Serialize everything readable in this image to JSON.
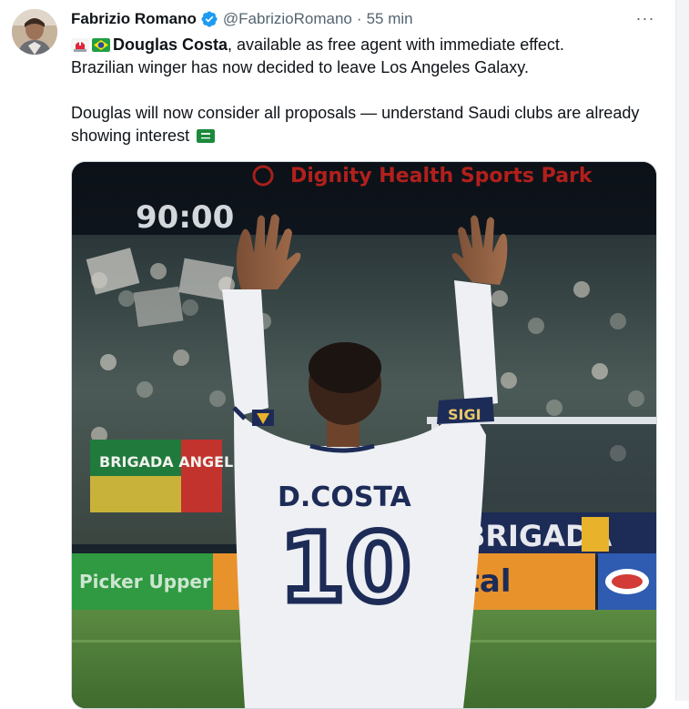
{
  "tweet": {
    "author": {
      "display_name": "Fabrizio Romano",
      "handle": "@FabrizioRomano",
      "verified": true,
      "avatar_icon": "avatar-photo"
    },
    "separator": "·",
    "time": "55 min",
    "more_icon": "more-horizontal-icon",
    "more_label": "···",
    "text": {
      "line1_flags": [
        "siren-emoji",
        "brazil-flag"
      ],
      "player_name": "Douglas Costa",
      "line1_rest": ", available as free agent with immediate effect.",
      "line2": "Brazilian winger has now decided to leave Los Angeles Galaxy.",
      "para2": "Douglas will now consider all proposals — understand Saudi clubs are already showing interest",
      "para2_flag": "saudi-flag"
    },
    "media": {
      "stadium_sign": "Dignity Health Sports Park",
      "scoreboard": "90:00",
      "jersey_name": "D.COSTA",
      "jersey_number": "10",
      "armband": "SIGI",
      "banner_left": "BRIGADA ANGELES",
      "banner_right": "BRIGADA",
      "ad_left": "Picker Upper",
      "ad_mid": "ital",
      "colors": {
        "sign_red": "#d0231c",
        "jersey": "#eef0f3",
        "navy": "#1d2b57",
        "ad_green": "#2f9a41",
        "ad_orange": "#e8922c",
        "ad_blue": "#2f5bb0",
        "pitch": "#4f7a39"
      }
    }
  }
}
